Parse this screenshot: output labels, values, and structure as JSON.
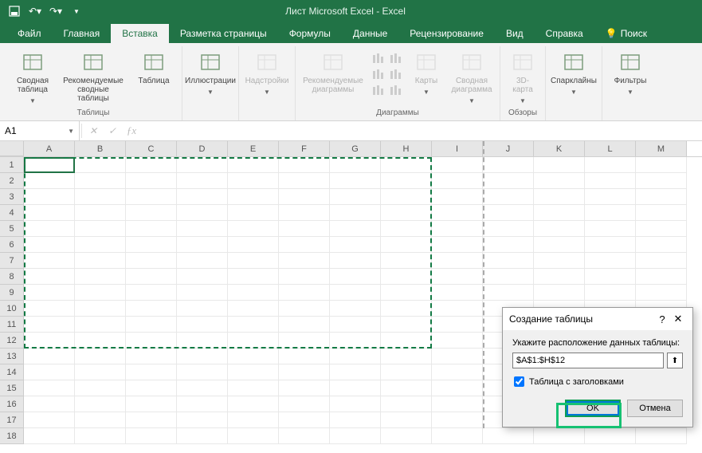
{
  "title": "Лист Microsoft Excel  -  Excel",
  "tabs": [
    "Файл",
    "Главная",
    "Вставка",
    "Разметка страницы",
    "Формулы",
    "Данные",
    "Рецензирование",
    "Вид",
    "Справка"
  ],
  "active_tab_index": 2,
  "tell_me": "Поиск",
  "ribbon": {
    "groups": [
      {
        "label": "Таблицы",
        "items": [
          {
            "name": "pivot-table",
            "label": "Сводная\nтаблица",
            "dd": true
          },
          {
            "name": "recommended-pivot",
            "label": "Рекомендуемые\nсводные таблицы"
          },
          {
            "name": "table",
            "label": "Таблица"
          }
        ]
      },
      {
        "label": "",
        "items": [
          {
            "name": "illustrations",
            "label": "Иллюстрации",
            "dd": true
          }
        ]
      },
      {
        "label": "",
        "items": [
          {
            "name": "addins",
            "label": "Надстройки",
            "dd": true,
            "disabled": true
          }
        ]
      },
      {
        "label": "Диаграммы",
        "items": [
          {
            "name": "recommended-charts",
            "label": "Рекомендуемые\nдиаграммы",
            "disabled": true
          },
          {
            "name": "chart-gallery",
            "small": true,
            "disabled": true
          },
          {
            "name": "maps",
            "label": "Карты",
            "dd": true,
            "disabled": true,
            "narrow": true
          },
          {
            "name": "pivot-chart",
            "label": "Сводная\nдиаграмма",
            "dd": true,
            "disabled": true
          }
        ]
      },
      {
        "label": "Обзоры",
        "items": [
          {
            "name": "3d-map",
            "label": "3D-\nкарта",
            "dd": true,
            "disabled": true,
            "narrow": true
          }
        ]
      },
      {
        "label": "",
        "items": [
          {
            "name": "sparklines",
            "label": "Спарклайны",
            "dd": true
          }
        ]
      },
      {
        "label": "",
        "items": [
          {
            "name": "filters",
            "label": "Фильтры",
            "dd": true
          }
        ]
      }
    ]
  },
  "name_box": "A1",
  "formula": "",
  "columns": [
    "A",
    "B",
    "C",
    "D",
    "E",
    "F",
    "G",
    "H",
    "I",
    "J",
    "K",
    "L",
    "M"
  ],
  "row_count": 18,
  "selection": {
    "range": "A1:H12",
    "active_cell": "A1"
  },
  "dialog": {
    "title": "Создание таблицы",
    "label": "Укажите расположение данных таблицы:",
    "range_value": "$A$1:$H$12",
    "checkbox_label": "Таблица с заголовками",
    "checkbox_checked": true,
    "ok": "OK",
    "cancel": "Отмена"
  }
}
